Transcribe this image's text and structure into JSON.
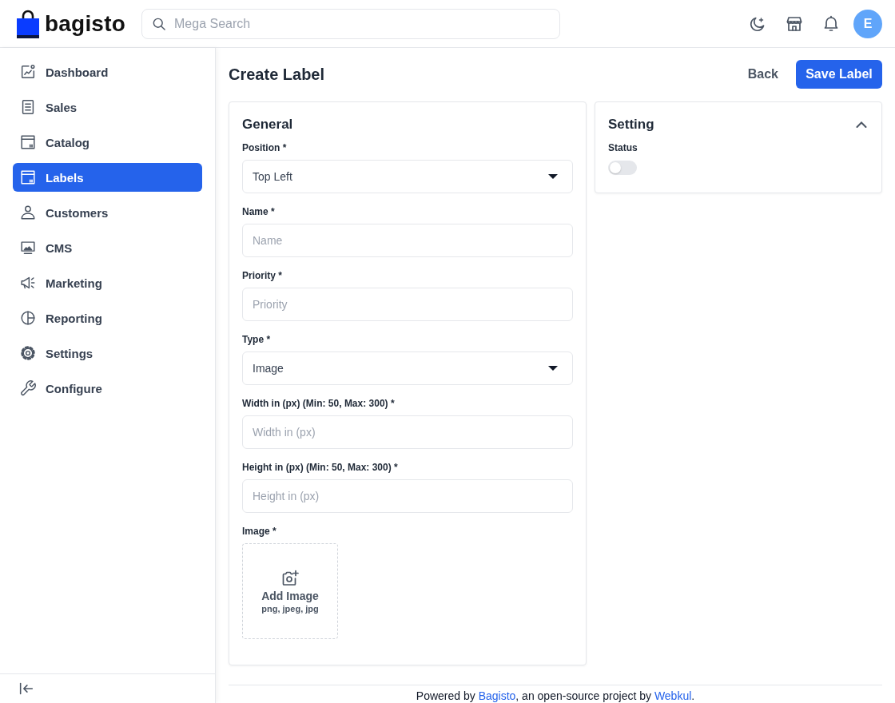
{
  "header": {
    "logo_text": "bagisto",
    "search": {
      "placeholder": "Mega Search"
    },
    "avatar": "E"
  },
  "sidebar": {
    "items": [
      {
        "label": "Dashboard",
        "selected": false
      },
      {
        "label": "Sales",
        "selected": false
      },
      {
        "label": "Catalog",
        "selected": false
      },
      {
        "label": "Labels",
        "selected": true
      },
      {
        "label": "Customers",
        "selected": false
      },
      {
        "label": "CMS",
        "selected": false
      },
      {
        "label": "Marketing",
        "selected": false
      },
      {
        "label": "Reporting",
        "selected": false
      },
      {
        "label": "Settings",
        "selected": false
      },
      {
        "label": "Configure",
        "selected": false
      }
    ]
  },
  "page": {
    "title": "Create Label",
    "back": "Back",
    "save": "Save Label"
  },
  "general": {
    "title": "General",
    "fields": [
      {
        "kind": "select",
        "label": "Position *",
        "value": "Top Left"
      },
      {
        "kind": "text",
        "label": "Name *",
        "placeholder": "Name"
      },
      {
        "kind": "text",
        "label": "Priority *",
        "placeholder": "Priority"
      },
      {
        "kind": "select",
        "label": "Type *",
        "value": "Image"
      },
      {
        "kind": "text",
        "label": "Width in (px) (Min: 50, Max: 300) *",
        "placeholder": "Width in (px)"
      },
      {
        "kind": "text",
        "label": "Height in (px) (Min: 50, Max: 300) *",
        "placeholder": "Height in (px)"
      },
      {
        "kind": "image",
        "label": "Image *",
        "button": "Add Image",
        "hint": "png, jpeg, jpg"
      }
    ]
  },
  "setting": {
    "title": "Setting",
    "expanded": true,
    "fields": [
      {
        "kind": "toggle",
        "label": "Status",
        "on": false
      }
    ]
  },
  "footer": {
    "segments": [
      {
        "text": "Powered by ",
        "link": false
      },
      {
        "text": "Bagisto",
        "link": true
      },
      {
        "text": ", an open-source project by ",
        "link": false
      },
      {
        "text": "Webkul",
        "link": true
      },
      {
        "text": ".",
        "link": false
      }
    ]
  }
}
